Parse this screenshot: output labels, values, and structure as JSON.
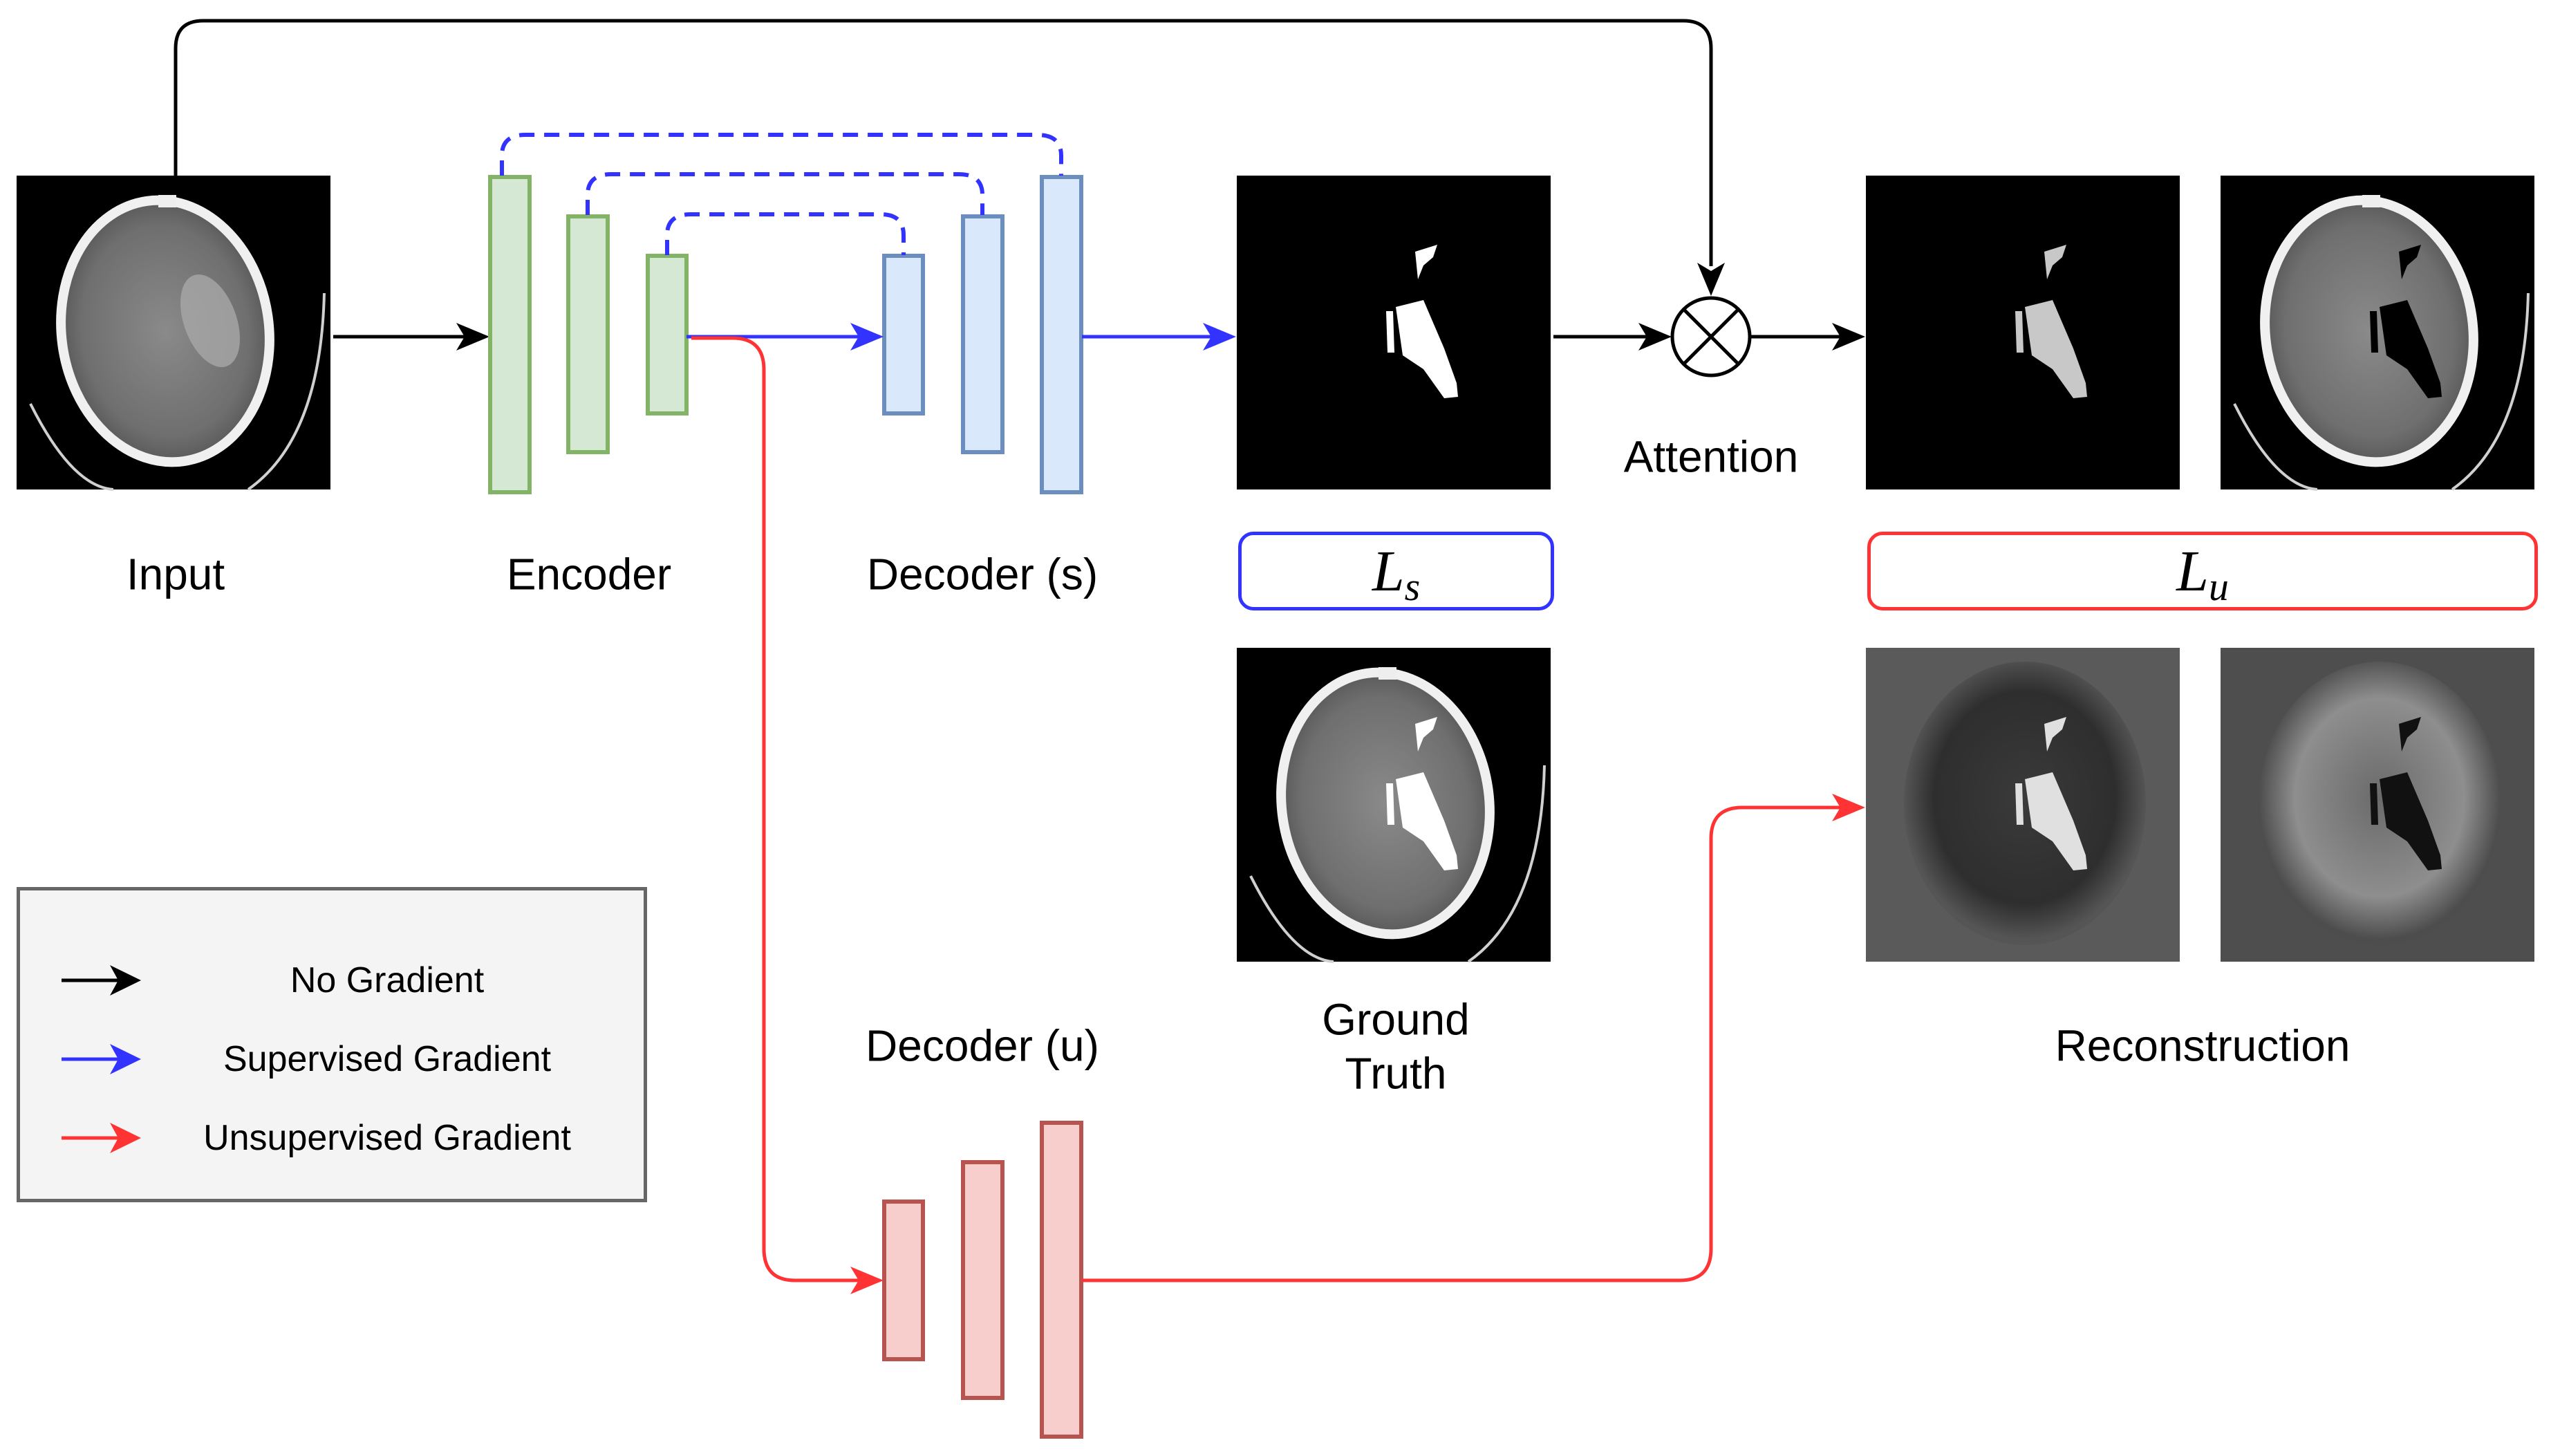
{
  "labels": {
    "input": "Input",
    "encoder": "Encoder",
    "decoder_s": "Decoder (s)",
    "decoder_u": "Decoder (u)",
    "attention": "Attention",
    "ground_truth_line1": "Ground",
    "ground_truth_line2": "Truth",
    "reconstruction": "Reconstruction"
  },
  "losses": {
    "supervised": {
      "symbol": "L",
      "subscript": "s",
      "color": "#3333ff"
    },
    "unsupervised": {
      "symbol": "L",
      "subscript": "u",
      "color": "#ff3333"
    }
  },
  "legend": {
    "items": [
      {
        "label": "No Gradient",
        "color": "#000000"
      },
      {
        "label": "Supervised Gradient",
        "color": "#3333ff"
      },
      {
        "label": "Unsupervised Gradient",
        "color": "#ff3333"
      }
    ]
  },
  "colors": {
    "encoder_fill": "#d5e8d4",
    "encoder_stroke": "#82b366",
    "decoder_s_fill": "#dae8fc",
    "decoder_s_stroke": "#6c8ebf",
    "decoder_u_fill": "#f8cecc",
    "decoder_u_stroke": "#b85450",
    "no_gradient": "#000000",
    "supervised": "#3333ff",
    "unsupervised": "#ff3333"
  },
  "images": {
    "input": "ct-scan-input",
    "predicted_mask": "hemorrhage-mask",
    "masked_lesion": "attention-masked-lesion",
    "masked_brain": "attention-masked-brain",
    "ground_truth": "ground-truth-overlay",
    "reconstruction_lesion": "reconstructed-lesion",
    "reconstruction_brain": "reconstructed-brain"
  }
}
